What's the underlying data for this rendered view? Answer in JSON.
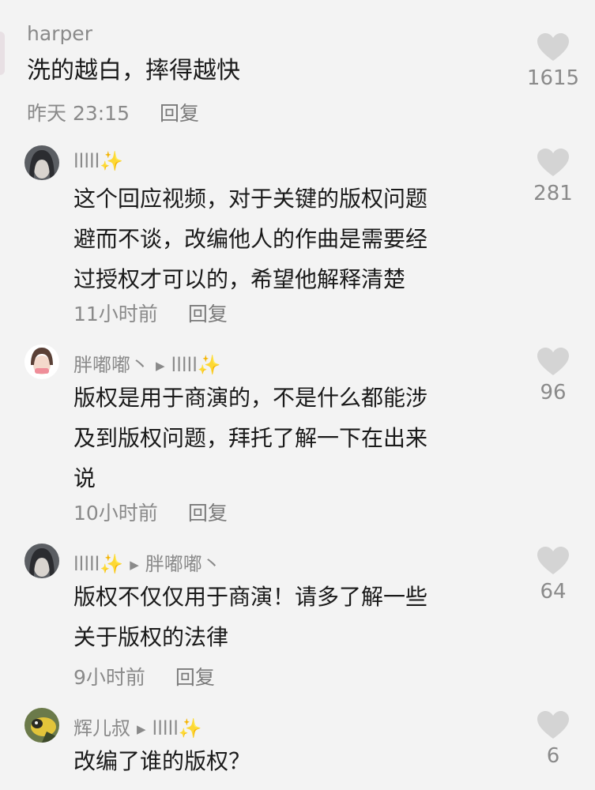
{
  "comments": [
    {
      "username": "harper",
      "text": "洗的越白，摔得越快",
      "time": "昨天 23:15",
      "reply_label": "回复",
      "likes": "1615"
    },
    {
      "username": "lllll",
      "username_suffix": "✨",
      "text_lines": [
        "这个回应视频，对于关键的版权问题",
        "避而不谈，改编他人的作曲是需要经",
        "过授权才可以的，希望他解释清楚"
      ],
      "time": "11小时前",
      "reply_label": "回复",
      "likes": "281"
    },
    {
      "username": "胖嘟嘟丶",
      "reply_to": "lllll",
      "reply_to_suffix": "✨",
      "text_lines": [
        "版权是用于商演的，不是什么都能涉",
        "及到版权问题，拜托了解一下在出来",
        "说"
      ],
      "time": "10小时前",
      "reply_label": "回复",
      "likes": "96"
    },
    {
      "username": "lllll",
      "username_suffix": "✨",
      "reply_to": "胖嘟嘟丶",
      "text_lines": [
        "版权不仅仅用于商演！请多了解一些",
        "关于版权的法律"
      ],
      "time": "9小时前",
      "reply_label": "回复",
      "likes": "64"
    },
    {
      "username": "辉儿叔",
      "reply_to": "lllll",
      "reply_to_suffix": "✨",
      "text": "改编了谁的版权？",
      "likes": "6"
    }
  ],
  "colors": {
    "background": "#f3f3f3",
    "muted": "#8a8a8a",
    "heart": "#d4d4d4",
    "sparkle": "#f2c33a"
  },
  "icons": {
    "like": "heart-icon",
    "reply_arrow": "play-triangle-icon"
  }
}
